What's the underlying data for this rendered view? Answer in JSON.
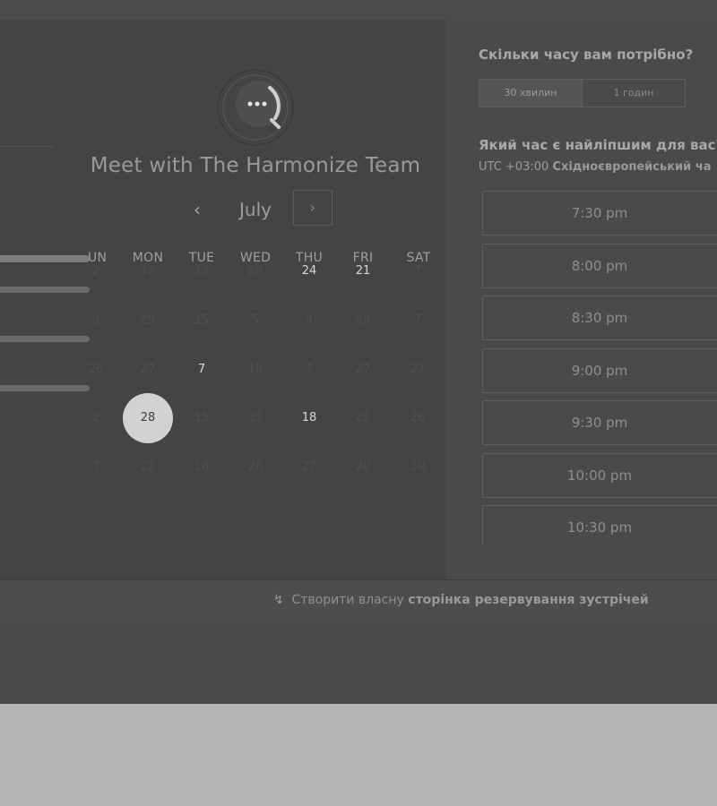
{
  "left": {
    "title": "Meet with The Harmonize Team",
    "month": "July",
    "prev_icon": "‹",
    "next_icon": "›",
    "weekdays": [
      "UN",
      "MON",
      "TUE",
      "WED",
      "THU",
      "FRI",
      "SAT"
    ],
    "weeks": [
      [
        "2",
        "12",
        "13",
        "20",
        "24",
        "21",
        "7"
      ],
      [
        "3",
        "29",
        "15",
        "5",
        "4",
        "28",
        "7"
      ],
      [
        "26",
        "27",
        "7",
        "19",
        "7",
        "27",
        "27"
      ],
      [
        "2",
        "28",
        "15",
        "31",
        "18",
        "22",
        "26"
      ],
      [
        "7",
        "22",
        "18",
        "26",
        "27",
        "20",
        "19"
      ]
    ]
  },
  "right": {
    "duration_question": "Скільки часу вам потрібно?",
    "durations": [
      "30 хвилин",
      "1 годин"
    ],
    "time_question": "Який час є найліпшим для вас?",
    "tz_offset": "UTC +03:00",
    "tz_name": "Східноєвропейський ча",
    "slots": [
      "7:30 pm",
      "8:00 pm",
      "8:30 pm",
      "9:00 pm",
      "9:30 pm",
      "10:00 pm",
      "10:30 pm"
    ]
  },
  "footer": {
    "icon": "↯",
    "link_prefix": "Створити власну",
    "link_strong": "сторінка резервування зустрічей"
  },
  "colors": {
    "panel_left": "#444444",
    "panel_right": "#4a4a4a",
    "selected_day": "#d2d2d2",
    "backdrop": "#b5b5b5"
  }
}
